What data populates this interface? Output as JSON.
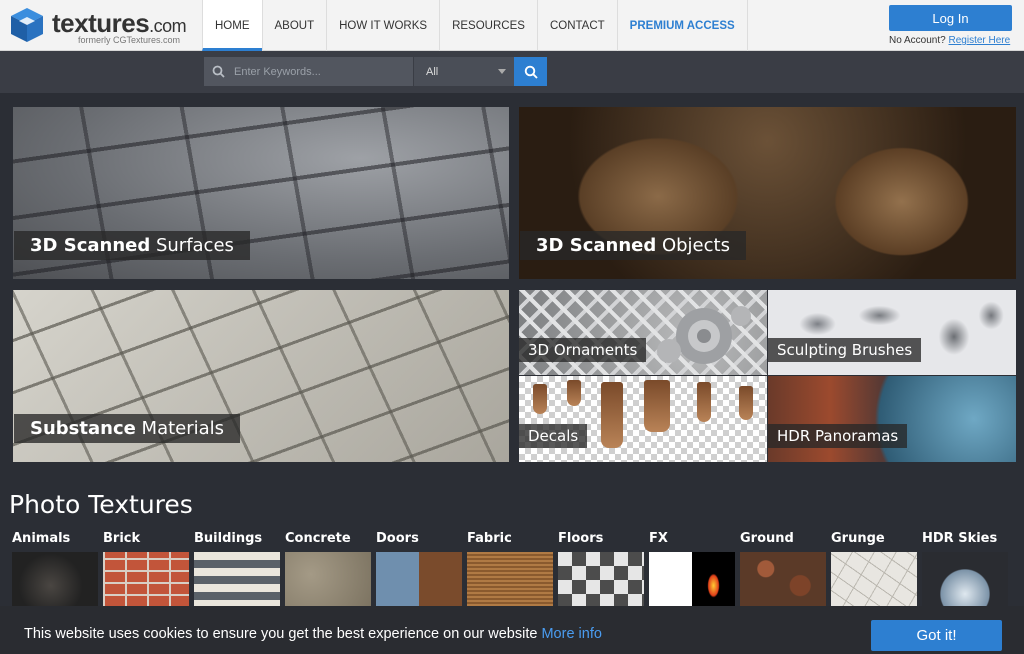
{
  "header": {
    "logo_text": "textures",
    "logo_tld": ".com",
    "logo_sub": "formerly CGTextures.com",
    "nav": [
      "HOME",
      "ABOUT",
      "HOW IT WORKS",
      "RESOURCES",
      "CONTACT",
      "PREMIUM ACCESS"
    ],
    "login_label": "Log In",
    "no_account": "No Account?",
    "register_label": "Register Here"
  },
  "search": {
    "placeholder": "Enter Keywords...",
    "category_value": "All"
  },
  "tiles": {
    "surfaces": {
      "bold": "3D Scanned",
      "rest": " Surfaces"
    },
    "objects": {
      "bold": "3D Scanned",
      "rest": " Objects"
    },
    "substance": {
      "bold": "Substance",
      "rest": " Materials"
    },
    "ornaments": "3D Ornaments",
    "brushes": "Sculpting Brushes",
    "decals": "Decals",
    "hdr": "HDR Panoramas"
  },
  "photo_textures": {
    "heading": "Photo Textures",
    "categories": [
      "Animals",
      "Brick",
      "Buildings",
      "Concrete",
      "Doors",
      "Fabric",
      "Floors",
      "FX",
      "Ground",
      "Grunge",
      "HDR Skies"
    ]
  },
  "cookie": {
    "message": "This website uses cookies to ensure you get the best experience on our website",
    "more_info": "More info",
    "button": "Got it!"
  },
  "colors": {
    "accent": "#2d7fd1",
    "background": "#2b2e35"
  }
}
